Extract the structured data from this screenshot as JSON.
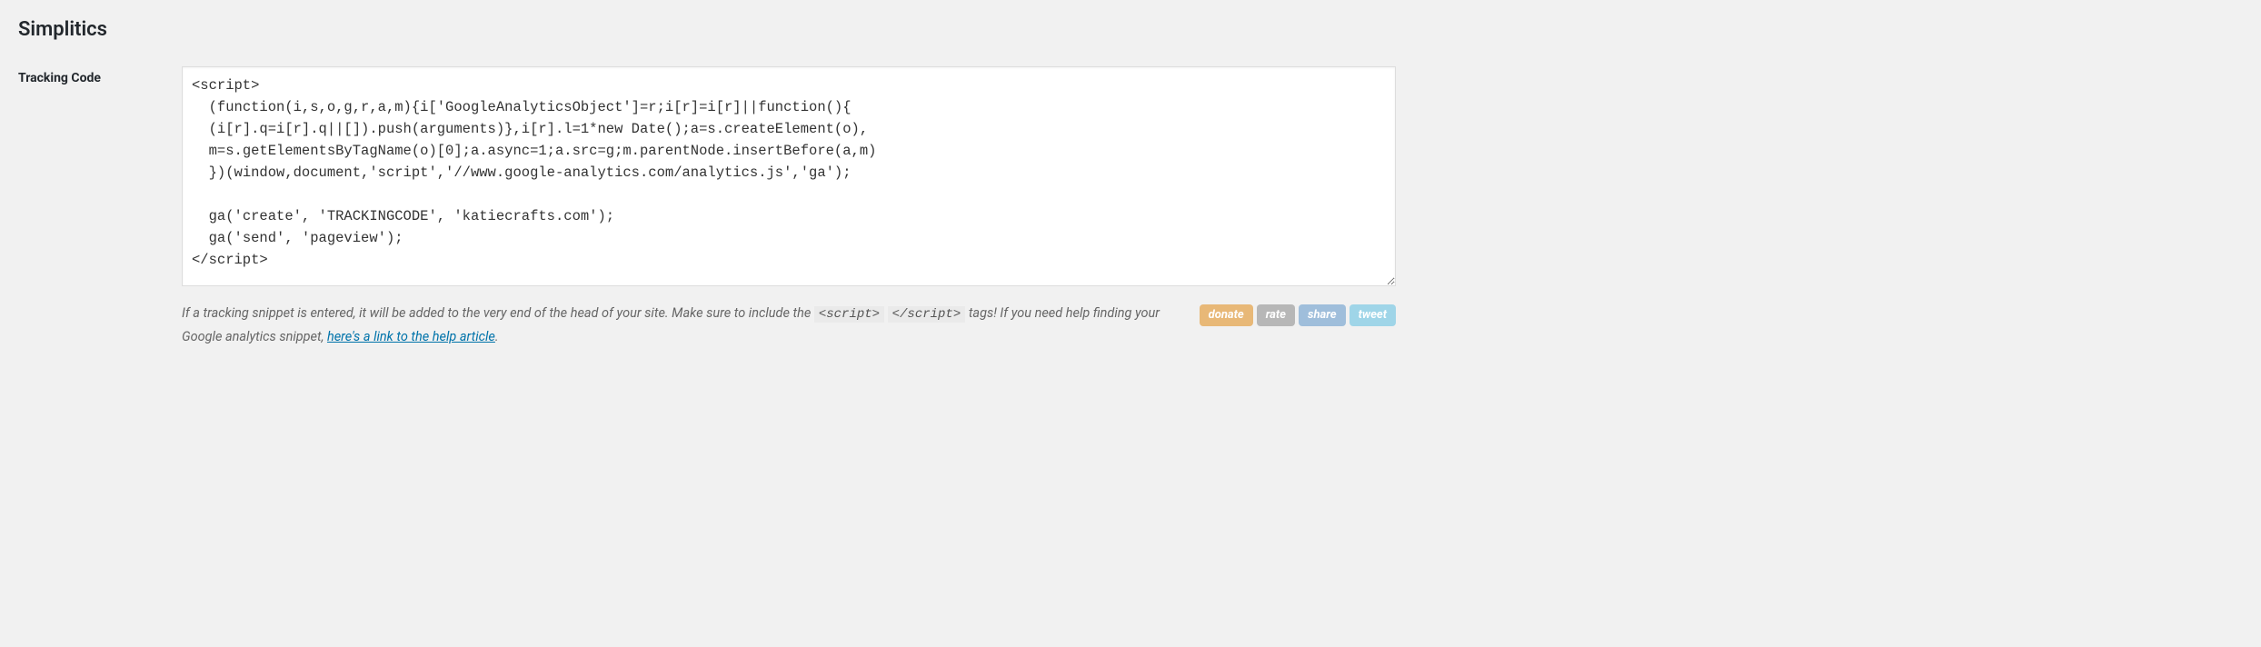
{
  "page": {
    "title": "Simplitics"
  },
  "form": {
    "label": "Tracking Code",
    "textarea_value": "<script>\n  (function(i,s,o,g,r,a,m){i['GoogleAnalyticsObject']=r;i[r]=i[r]||function(){\n  (i[r].q=i[r].q||[]).push(arguments)},i[r].l=1*new Date();a=s.createElement(o),\n  m=s.getElementsByTagName(o)[0];a.async=1;a.src=g;m.parentNode.insertBefore(a,m)\n  })(window,document,'script','//www.google-analytics.com/analytics.js','ga');\n\n  ga('create', 'TRACKINGCODE', 'katiecrafts.com');\n  ga('send', 'pageview');\n</script>"
  },
  "description": {
    "part1": "If a tracking snippet is entered, it will be added to the very end of the head of your site. Make sure to include the ",
    "code1": "<script>",
    "code2": "</script>",
    "part2": " tags! If you need help finding your Google analytics snippet, ",
    "link_text": "here's a link to the help article",
    "part3": "."
  },
  "buttons": {
    "donate": "donate",
    "rate": "rate",
    "share": "share",
    "tweet": "tweet"
  }
}
